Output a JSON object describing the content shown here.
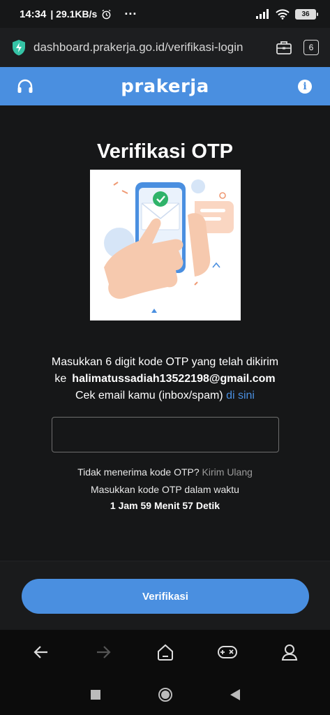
{
  "status_bar": {
    "time": "14:34",
    "net_speed": "| 29.1KB/s",
    "more": "···",
    "battery": "36"
  },
  "browser": {
    "url": "dashboard.prakerja.go.id/verifikasi-login",
    "tab_count": "6"
  },
  "header": {
    "brand": "prakerja",
    "info": "i"
  },
  "main": {
    "title": "Verifikasi OTP",
    "instruction": "Masukkan 6 digit kode OTP yang telah dikirim",
    "email_prefix": "ke",
    "email": "halimatussadiah13522198@gmail.com",
    "check_email": "Cek email kamu (inbox/spam)",
    "check_email_link": "di sini",
    "otp_value": "",
    "resend_text": "Tidak menerima kode OTP?",
    "resend_link": "Kirim Ulang",
    "timer_label": "Masukkan kode OTP dalam waktu",
    "timer": "1 Jam 59 Menit 57 Detik"
  },
  "footer": {
    "verify_label": "Verifikasi"
  },
  "colors": {
    "accent": "#4a8fe0",
    "background": "#161718"
  },
  "icons": [
    "alarm-icon",
    "signal-icon",
    "wifi-icon",
    "battery-icon",
    "shield-icon",
    "briefcase-icon",
    "headset-icon",
    "info-icon",
    "back-icon",
    "forward-icon",
    "home-icon",
    "gamepad-icon",
    "profile-icon",
    "recents-icon",
    "system-home-icon",
    "system-back-icon"
  ]
}
